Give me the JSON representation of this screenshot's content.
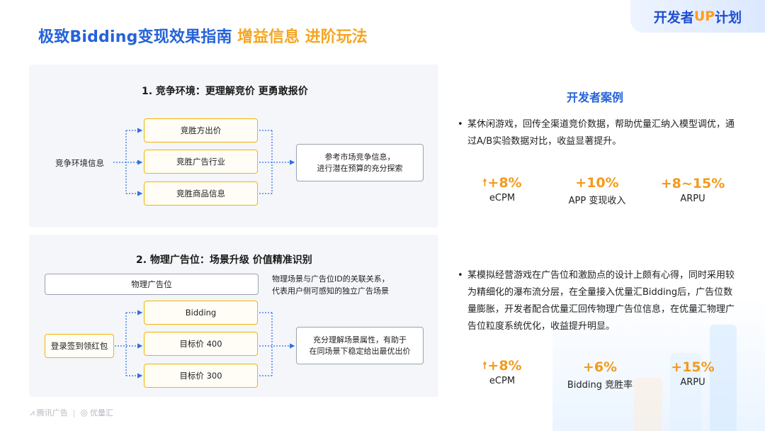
{
  "header": {
    "title_main": "极致Bidding变现效果指南",
    "title_sub": "增益信息 进阶玩法",
    "badge_prefix": "开发者",
    "badge_up": "UP",
    "badge_suffix": "计划"
  },
  "section1": {
    "title": "1. 竞争环境：更理解竞价 更勇敢报价",
    "source_label": "竞争环境信息",
    "boxes": [
      "竞胜方出价",
      "竞胜广告行业",
      "竞胜商品信息"
    ],
    "result_line1": "参考市场竞争信息，",
    "result_line2": "进行潜在预算的充分探索"
  },
  "section2": {
    "title": "2. 物理广告位：场景升级 价值精准识别",
    "physical_box": "物理广告位",
    "note_line1": "物理场景与广告位ID的关联关系，",
    "note_line2": "代表用户侧可感知的独立广告场景",
    "source_label": "登录签到领红包",
    "boxes": [
      "Bidding",
      "目标价 400",
      "目标价 300"
    ],
    "result_line1": "充分理解场景属性，有助于",
    "result_line2": "在同场景下稳定给出最优出价"
  },
  "cases": {
    "title": "开发者案例",
    "case1": {
      "text": "某休闲游戏，回传全渠道竞价数据，帮助优量汇纳入模型调优，通过A/B实验数据对比，收益显著提升。",
      "metrics": [
        {
          "value": "+8%",
          "label": "eCPM",
          "arrow": true
        },
        {
          "value": "+10%",
          "label": "APP 变现收入",
          "arrow": false
        },
        {
          "value": "+8~15%",
          "label": "ARPU",
          "arrow": false
        }
      ]
    },
    "case2": {
      "text": "某模拟经营游戏在广告位和激励点的设计上颇有心得，同时采用较为精细化的瀑布流分层，在全量接入优量汇Bidding后，广告位数量膨胀，开发者配合优量汇回传物理广告位信息，在优量汇物理广告位粒度系统优化，收益提升明显。",
      "metrics": [
        {
          "value": "+8%",
          "label": "eCPM",
          "arrow": true
        },
        {
          "value": "+6%",
          "label": "Bidding 竞胜率",
          "arrow": false
        },
        {
          "value": "+15%",
          "label": "ARPU",
          "arrow": false
        }
      ]
    }
  },
  "footer": {
    "brand1": "腾讯广告",
    "brand2": "优量汇"
  },
  "colors": {
    "primary_blue": "#2563d8",
    "accent_orange": "#f39a1c",
    "box_yellow": "#f5b400",
    "panel_bg": "#f4f6fa"
  }
}
